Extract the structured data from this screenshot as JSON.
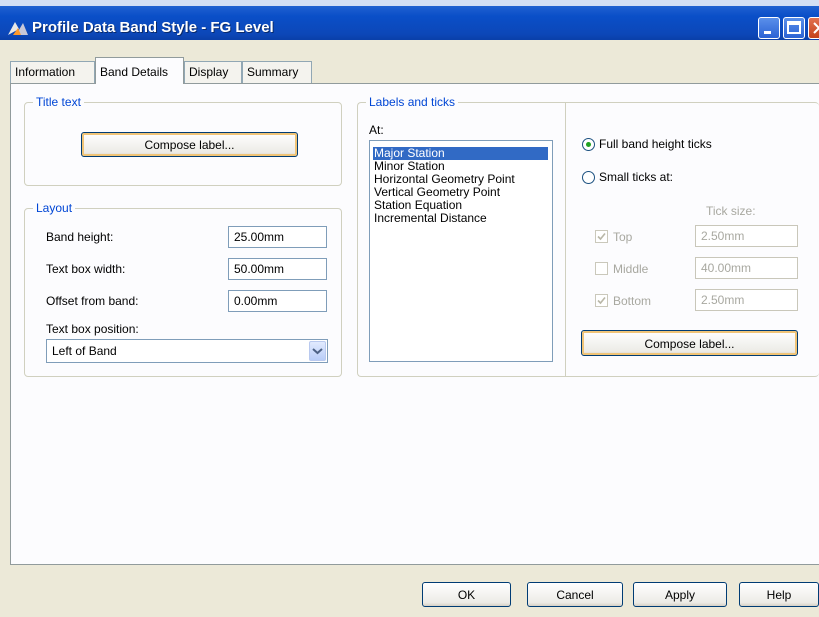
{
  "window": {
    "title": "Profile Data Band Style - FG Level",
    "controls": [
      "minimize-icon",
      "maximize-icon",
      "close-icon"
    ]
  },
  "tabs": [
    {
      "label": "Information",
      "active": false
    },
    {
      "label": "Band Details",
      "active": true
    },
    {
      "label": "Display",
      "active": false
    },
    {
      "label": "Summary",
      "active": false
    }
  ],
  "title_text": {
    "group_label": "Title text",
    "compose_button": "Compose label..."
  },
  "layout": {
    "group_label": "Layout",
    "band_height_label": "Band height:",
    "band_height_value": "25.00mm",
    "text_box_width_label": "Text box width:",
    "text_box_width_value": "50.00mm",
    "offset_label": "Offset from band:",
    "offset_value": "0.00mm",
    "position_label": "Text box position:",
    "position_value": "Left of Band"
  },
  "labels_ticks": {
    "group_label": "Labels and ticks",
    "at_label": "At:",
    "items": [
      "Major Station",
      "Minor Station",
      "Horizontal Geometry Point",
      "Vertical Geometry Point",
      "Station Equation",
      "Incremental Distance"
    ],
    "selected_index": 0,
    "full_band_label": "Full band height ticks",
    "small_ticks_label": "Small ticks at:",
    "tick_size_label": "Tick size:",
    "top_label": "Top",
    "top_checked": true,
    "top_value": "2.50mm",
    "middle_label": "Middle",
    "middle_checked": false,
    "middle_value": "40.00mm",
    "bottom_label": "Bottom",
    "bottom_checked": true,
    "bottom_value": "2.50mm",
    "compose_button": "Compose label..."
  },
  "footer": {
    "ok": "OK",
    "cancel": "Cancel",
    "apply": "Apply",
    "help": "Help"
  },
  "colors": {
    "titlebar": "#0a4fc8",
    "group_label": "#0046d5",
    "selection": "#316ac5"
  }
}
